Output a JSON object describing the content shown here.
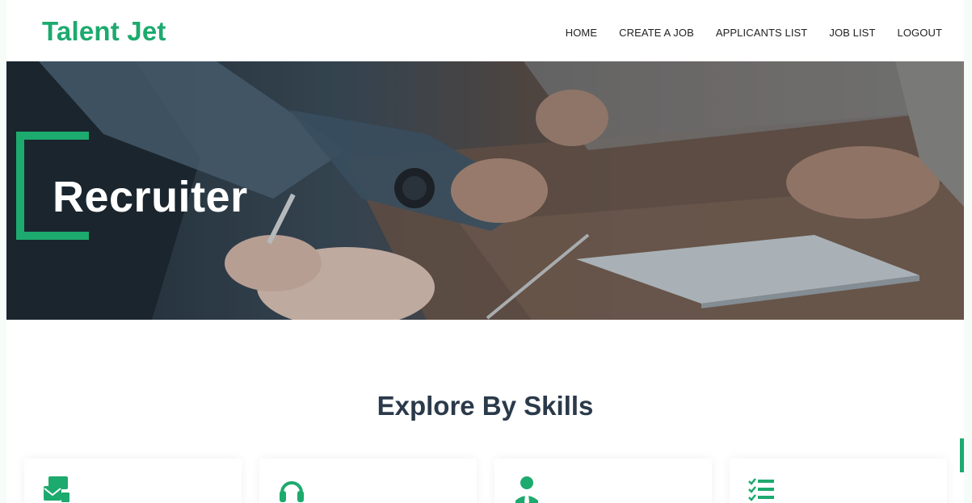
{
  "brand": {
    "name": "Talent Jet",
    "accent": "#1daa6e"
  },
  "nav": [
    {
      "label": "HOME"
    },
    {
      "label": "CREATE A JOB"
    },
    {
      "label": "APPLICANTS LIST"
    },
    {
      "label": "JOB LIST"
    },
    {
      "label": "LOGOUT"
    }
  ],
  "hero": {
    "title": "Recruiter"
  },
  "explore": {
    "title": "Explore By Skills",
    "cards": [
      {
        "icon": "mail-cards-icon"
      },
      {
        "icon": "headset-icon"
      },
      {
        "icon": "user-tie-icon"
      },
      {
        "icon": "checklist-icon"
      }
    ]
  }
}
